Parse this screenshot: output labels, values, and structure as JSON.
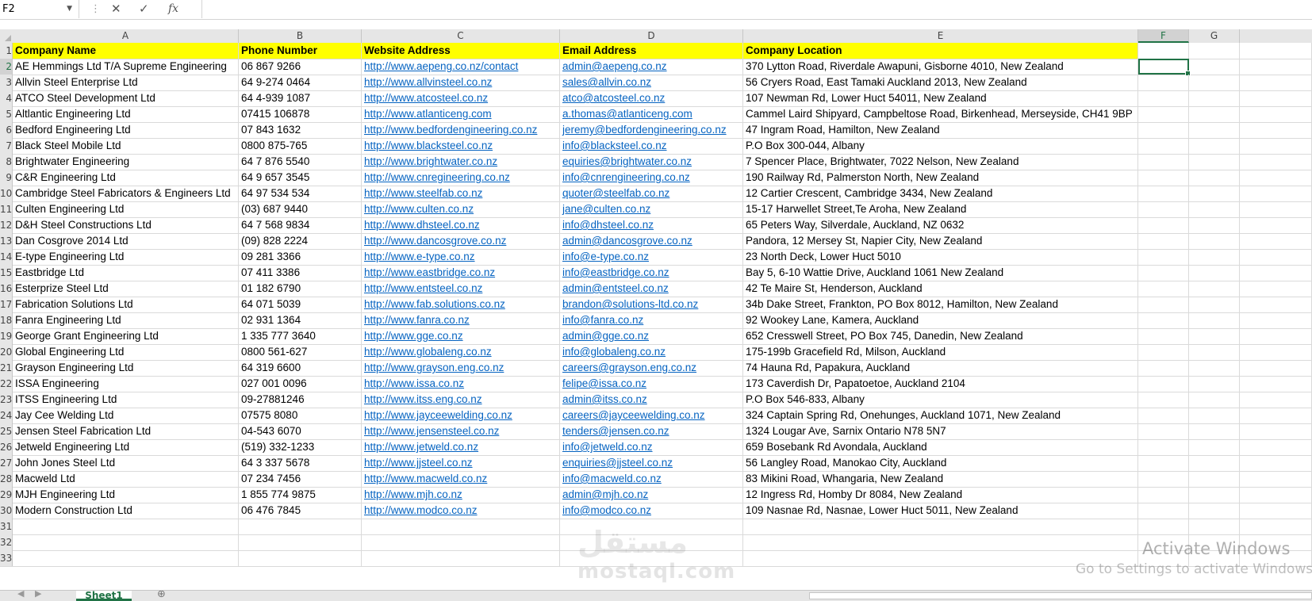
{
  "formula_bar": {
    "name_box": "F2",
    "cancel_icon": "✕",
    "enter_icon": "✓",
    "fx_label": "fx",
    "formula": ""
  },
  "columns": [
    "A",
    "B",
    "C",
    "D",
    "E",
    "F",
    "G"
  ],
  "selected_cell": "F2",
  "headers": {
    "company": "Company Name",
    "phone": "Phone Number",
    "website": "Website Address",
    "email": "Email Address",
    "location": "Company Location"
  },
  "rows": [
    {
      "company": "AE Hemmings Ltd T/A Supreme Engineering",
      "phone": "06 867 9266",
      "website": "http://www.aepeng.co.nz/contact",
      "email": "admin@aepeng.co.nz",
      "location": "370 Lytton Road, Riverdale Awapuni, Gisborne 4010, New Zealand"
    },
    {
      "company": "Allvin Steel Enterprise Ltd",
      "phone": "64 9-274 0464",
      "website": "http://www.allvinsteel.co.nz",
      "email": "sales@allvin.co.nz",
      "location": "56 Cryers Road, East Tamaki Auckland 2013, New Zealand"
    },
    {
      "company": "ATCO Steel Development Ltd",
      "phone": "64 4-939 1087",
      "website": "http://www.atcosteel.co.nz",
      "email": "atco@atcosteel.co.nz",
      "location": "107 Newman Rd, Lower Huct 54011, New Zealand"
    },
    {
      "company": "Altlantic Engineering Ltd",
      "phone": "07415 106878",
      "website": "http://www.atlanticeng.com",
      "email": "a.thomas@atlanticeng.com",
      "location": "Cammel Laird Shipyard, Campbeltose Road, Birkenhead, Merseyside, CH41 9BP"
    },
    {
      "company": "Bedford Engineering Ltd",
      "phone": "07 843 1632",
      "website": "http://www.bedfordengineering.co.nz",
      "email": "jeremy@bedfordengineering.co.nz",
      "location": "47 Ingram Road, Hamilton, New Zealand"
    },
    {
      "company": "Black Steel Mobile Ltd",
      "phone": "0800 875-765",
      "website": "http://www.blacksteel.co.nz",
      "email": "info@blacksteel.co.nz",
      "location": "P.O Box 300-044, Albany"
    },
    {
      "company": "Brightwater Engineering",
      "phone": "64 7 876 5540",
      "website": "http://www.brightwater.co.nz",
      "email": "equiries@brightwater.co.nz",
      "location": "7 Spencer Place, Brightwater, 7022 Nelson, New Zealand"
    },
    {
      "company": "C&R Engineering Ltd",
      "phone": "64 9 657 3545",
      "website": "http://www.cnregineering.co.nz",
      "email": "info@cnrengineering.co.nz",
      "location": "190 Railway Rd, Palmerston North, New Zealand"
    },
    {
      "company": "Cambridge Steel Fabricators & Engineers Ltd",
      "phone": "64 97 534 534",
      "website": "http://www.steelfab.co.nz",
      "email": "quoter@steelfab.co.nz",
      "location": "12 Cartier Crescent, Cambridge 3434, New Zealand"
    },
    {
      "company": "Culten Engineering Ltd",
      "phone": "(03) 687 9440",
      "website": "http://www.culten.co.nz",
      "email": "jane@culten.co.nz",
      "location": "15-17 Harwellet Street,Te Aroha, New Zealand"
    },
    {
      "company": "D&H Steel Constructions Ltd",
      "phone": "64 7 568 9834",
      "website": "http://www.dhsteel.co.nz",
      "email": "info@dhsteel.co.nz",
      "location": "65 Peters Way, Silverdale, Auckland, NZ 0632"
    },
    {
      "company": "Dan Cosgrove 2014 Ltd",
      "phone": "(09) 828 2224",
      "website": "http://www.dancosgrove.co.nz",
      "email": "admin@dancosgrove.co.nz",
      "location": "Pandora, 12 Mersey St, Napier City, New Zealand"
    },
    {
      "company": "E-type Engineering Ltd",
      "phone": "09 281 3366",
      "website": "http://www.e-type.co.nz",
      "email": "info@e-type.co.nz",
      "location": "23 North Deck, Lower Huct 5010"
    },
    {
      "company": "Eastbridge Ltd",
      "phone": "07 411 3386",
      "website": "http://www.eastbridge.co.nz",
      "email": "info@eastbridge.co.nz",
      "location": "Bay 5, 6-10 Wattie Drive, Auckland 1061 New Zealand"
    },
    {
      "company": "Esterprize Steel Ltd",
      "phone": "01 182 6790",
      "website": "http://www.entsteel.co.nz",
      "email": "admin@entsteel.co.nz",
      "location": "42 Te Maire St, Henderson, Auckland"
    },
    {
      "company": "Fabrication Solutions Ltd",
      "phone": "64 071 5039",
      "website": "http://www.fab.solutions.co.nz",
      "email": "brandon@solutions-ltd.co.nz",
      "location": "34b Dake Street, Frankton, PO Box 8012, Hamilton, New Zealand"
    },
    {
      "company": "Fanra Engineering Ltd",
      "phone": "02 931 1364",
      "website": "http://www.fanra.co.nz",
      "email": "info@fanra.co.nz",
      "location": "92 Wookey Lane, Kamera, Auckland"
    },
    {
      "company": "George Grant Engineering Ltd",
      "phone": " 1 335 777 3640",
      "website": "http://www.gge.co.nz",
      "email": "admin@gge.co.nz",
      "location": "652 Cresswell Street, PO Box 745, Danedin, New Zealand"
    },
    {
      "company": "Global Engineering Ltd",
      "phone": "0800 561-627",
      "website": "http://www.globaleng.co.nz",
      "email": "info@globaleng.co.nz",
      "location": "175-199b Gracefield Rd, Milson, Auckland"
    },
    {
      "company": "Grayson Engineering Ltd",
      "phone": "64 319 6600",
      "website": "http://www.grayson.eng.co.nz",
      "email": "careers@grayson.eng.co.nz",
      "location": "74 Hauna Rd, Papakura, Auckland"
    },
    {
      "company": "ISSA Engineering",
      "phone": "027 001 0096",
      "website": "http://www.issa.co.nz",
      "email": "felipe@issa.co.nz",
      "location": "173 Caverdish Dr, Papatoetoe, Auckland 2104"
    },
    {
      "company": "ITSS Engineering Ltd",
      "phone": "09-27881246",
      "website": "http://www.itss.eng.co.nz",
      "email": "admin@itss.co.nz",
      "location": "P.O Box 546-833, Albany"
    },
    {
      "company": "Jay Cee Welding Ltd",
      "phone": "07575 8080",
      "website": "http://www.jayceewelding.co.nz",
      "email": "careers@jayceewelding.co.nz",
      "location": "324 Captain Spring Rd, Onehunges, Auckland 1071, New Zealand"
    },
    {
      "company": " Jensen Steel Fabrication Ltd",
      "phone": "04-543 6070",
      "website": "http://www.jensensteel.co.nz",
      "email": "tenders@jensen.co.nz",
      "location": "1324 Lougar Ave, Sarnix Ontario N78 5N7"
    },
    {
      "company": "Jetweld Engineering Ltd",
      "phone": "(519) 332-1233",
      "website": "http://www.jetweld.co.nz",
      "email": "info@jetweld.co.nz",
      "location": "659 Bosebank Rd Avondala, Auckland"
    },
    {
      "company": "John Jones Steel Ltd",
      "phone": "64 3 337 5678",
      "website": "http://www.jjsteel.co.nz",
      "email": "enquiries@jjsteel.co.nz",
      "location": "56 Langley Road, Manokao City, Auckland"
    },
    {
      "company": "Macweld Ltd",
      "phone": "07 234 7456",
      "website": "http://www.macweld.co.nz",
      "email": "info@macweld.co.nz",
      "location": "83 Mikini Road, Whangaria, New Zealand"
    },
    {
      "company": "MJH Engineering Ltd",
      "phone": "1 855 774 9875",
      "website": "http://www.mjh.co.nz",
      "email": "admin@mjh.co.nz",
      "location": "12 Ingress Rd, Homby Dr 8084, New Zealand"
    },
    {
      "company": "Modern Construction Ltd",
      "phone": "06 476 7845",
      "website": "http://www.modco.co.nz",
      "email": "info@modco.co.nz",
      "location": "109 Nasnae Rd, Nasnae, Lower Huct 5011, New Zealand"
    }
  ],
  "empty_row_numbers": [
    "31",
    "32",
    "33"
  ],
  "watermark": {
    "arabic": "مستقل",
    "latin": "mostaql.com"
  },
  "activation": {
    "title": "Activate Windows",
    "subtitle": "Go to Settings to activate Windows."
  },
  "sheet_tab": "Sheet1",
  "colors": {
    "header_fill": "#ffff00",
    "link": "#0563c1",
    "excel_green": "#217346"
  }
}
